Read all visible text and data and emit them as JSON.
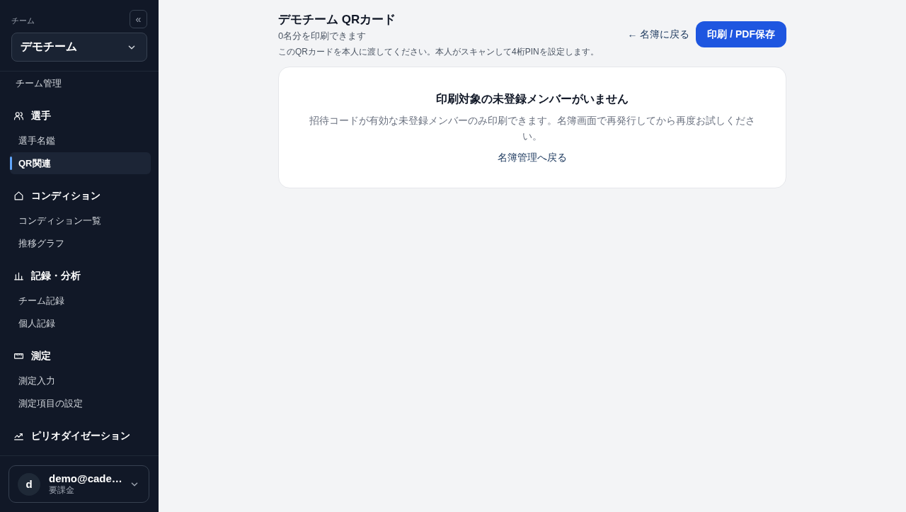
{
  "sidebar": {
    "team_label": "チーム",
    "collapse_button": "«",
    "team_select": {
      "value": "デモチーム"
    },
    "nav_groups": [
      {
        "items": [
          {
            "label": "チーム管理",
            "selected": false
          }
        ]
      },
      {
        "heading": "選手",
        "items": [
          {
            "label": "選手名鑑",
            "selected": false
          },
          {
            "label": "QR関連",
            "selected": true
          }
        ]
      },
      {
        "heading": "コンディション",
        "items": [
          {
            "label": "コンディション一覧",
            "selected": false
          },
          {
            "label": "推移グラフ",
            "selected": false
          }
        ]
      },
      {
        "heading": "記録・分析",
        "items": [
          {
            "label": "チーム記録",
            "selected": false
          },
          {
            "label": "個人記録",
            "selected": false
          }
        ]
      },
      {
        "heading": "測定",
        "items": [
          {
            "label": "測定入力",
            "selected": false
          },
          {
            "label": "測定項目の設定",
            "selected": false
          }
        ]
      },
      {
        "heading": "ピリオダイゼーション"
      }
    ],
    "account": {
      "avatar_initial": "d",
      "email": "demo@cade…",
      "plan": "要課金"
    }
  },
  "header": {
    "title": "デモチーム QRカード",
    "count": "0名分を印刷できます",
    "note": "このQRカードを本人に渡してください。本人がスキャンして4桁PINを設定します。",
    "back_link": "← 名簿に戻る",
    "print_button": "印刷 / PDF保存"
  },
  "empty_state": {
    "title": "印刷対象の未登録メンバーがいません",
    "message": "招待コードが有効な未登録メンバーのみ印刷できます。名簿画面で再発行してから再度お試しください。",
    "link": "名簿管理へ戻る"
  }
}
